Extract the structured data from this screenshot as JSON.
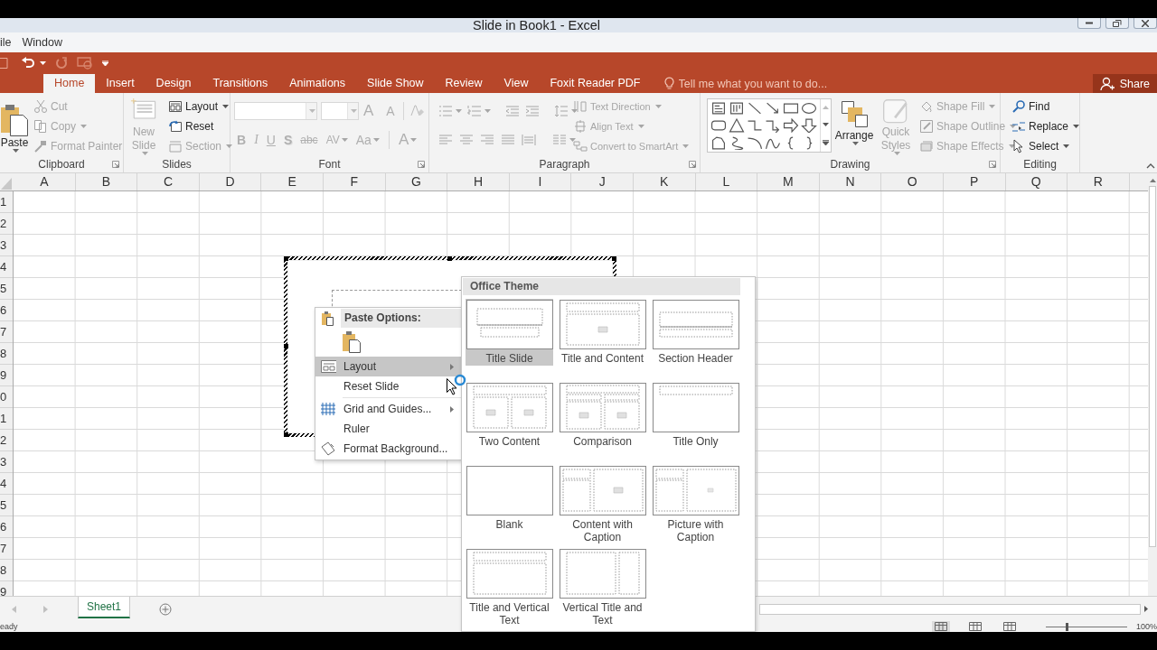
{
  "window": {
    "title": "Slide in Book1 - Excel"
  },
  "menu": [
    "ile",
    "Window"
  ],
  "tabs": [
    {
      "label": "Home",
      "selected": true
    },
    {
      "label": "Insert",
      "selected": false
    },
    {
      "label": "Design",
      "selected": false
    },
    {
      "label": "Transitions",
      "selected": false
    },
    {
      "label": "Animations",
      "selected": false
    },
    {
      "label": "Slide Show",
      "selected": false
    },
    {
      "label": "Review",
      "selected": false
    },
    {
      "label": "View",
      "selected": false
    },
    {
      "label": "Foxit Reader PDF",
      "selected": false
    }
  ],
  "tell_me": {
    "placeholder": "Tell me what you want to do..."
  },
  "share": "Share",
  "ribbon": {
    "clipboard": {
      "label": "Clipboard",
      "paste": {
        "label": "Paste",
        "disabled": false
      },
      "buttons": [
        {
          "label": "Cut",
          "disabled": true
        },
        {
          "label": "Copy",
          "disabled": true
        },
        {
          "label": "Format Painter",
          "disabled": true
        }
      ]
    },
    "slides": {
      "label": "Slides",
      "new_slide": {
        "label": "New Slide",
        "disabled": true
      },
      "buttons": [
        {
          "label": "Layout",
          "disabled": false
        },
        {
          "label": "Reset",
          "disabled": false
        },
        {
          "label": "Section",
          "disabled": true
        }
      ]
    },
    "font": {
      "label": "Font",
      "size_buttons": [
        {
          "label": "A",
          "disabled": true
        },
        {
          "label": "A",
          "disabled": true
        }
      ],
      "format_buttons": [
        {
          "label": "B",
          "disabled": true
        },
        {
          "label": "I",
          "disabled": true
        },
        {
          "label": "U",
          "disabled": true
        },
        {
          "label": "S",
          "disabled": true
        },
        {
          "label": "abc",
          "disabled": true
        },
        {
          "label": "AV",
          "disabled": true
        },
        {
          "label": "Aa",
          "disabled": true
        },
        {
          "label": "A",
          "disabled": true
        }
      ]
    },
    "paragraph": {
      "label": "Paragraph",
      "buttons": [
        {
          "label": "Text Direction",
          "disabled": true
        },
        {
          "label": "Align Text",
          "disabled": true
        },
        {
          "label": "Convert to SmartArt",
          "disabled": true
        }
      ]
    },
    "drawing": {
      "label": "Drawing",
      "arrange": {
        "label": "Arrange",
        "disabled": false
      },
      "quick_styles": {
        "label": "Quick Styles",
        "disabled": true
      },
      "buttons": [
        {
          "label": "Shape Fill",
          "disabled": true
        },
        {
          "label": "Shape Outline",
          "disabled": true
        },
        {
          "label": "Shape Effects",
          "disabled": true
        }
      ]
    },
    "editing": {
      "label": "Editing",
      "buttons": [
        {
          "label": "Find",
          "disabled": false
        },
        {
          "label": "Replace",
          "disabled": false
        },
        {
          "label": "Select",
          "disabled": false
        }
      ]
    }
  },
  "sheet": {
    "columns": [
      "A",
      "B",
      "C",
      "D",
      "E",
      "F",
      "G",
      "H",
      "I",
      "J",
      "K",
      "L",
      "M",
      "N",
      "O",
      "P",
      "Q",
      "R"
    ],
    "rows": [
      "1",
      "2",
      "3",
      "4",
      "5",
      "6",
      "7",
      "8",
      "9",
      "0",
      "1",
      "2",
      "3",
      "4",
      "5",
      "6",
      "7",
      "8",
      "9"
    ]
  },
  "context_menu": {
    "header": "Paste Options:",
    "items": [
      {
        "label": "Layout",
        "selected": true,
        "submenu": true
      },
      {
        "label": "Reset Slide",
        "selected": false,
        "submenu": false
      },
      {
        "label": "Grid and Guides...",
        "selected": false,
        "submenu": true
      },
      {
        "label": "Ruler",
        "selected": false,
        "submenu": false
      },
      {
        "label": "Format Background...",
        "selected": false,
        "submenu": false
      }
    ]
  },
  "layout_gallery": {
    "title": "Office Theme",
    "layouts": [
      {
        "label": "Title Slide",
        "kind": "title",
        "selected": true
      },
      {
        "label": "Title and Content",
        "kind": "title_content",
        "selected": false
      },
      {
        "label": "Section Header",
        "kind": "section",
        "selected": false
      },
      {
        "label": "Two Content",
        "kind": "two_content",
        "selected": false
      },
      {
        "label": "Comparison",
        "kind": "comparison",
        "selected": false
      },
      {
        "label": "Title Only",
        "kind": "title_only",
        "selected": false
      },
      {
        "label": "Blank",
        "kind": "blank",
        "selected": false
      },
      {
        "label": "Content with Caption",
        "kind": "content_caption",
        "selected": false
      },
      {
        "label": "Picture with Caption",
        "kind": "picture_caption",
        "selected": false
      },
      {
        "label": "Title and Vertical Text",
        "kind": "title_vertical",
        "selected": false
      },
      {
        "label": "Vertical Title and Text",
        "kind": "vertical_title",
        "selected": false
      }
    ]
  },
  "sheet_tabs": [
    {
      "label": "Sheet1",
      "selected": true
    }
  ],
  "status": {
    "text": "eady",
    "zoom": {
      "level": 0.25,
      "reading": "100%"
    }
  }
}
